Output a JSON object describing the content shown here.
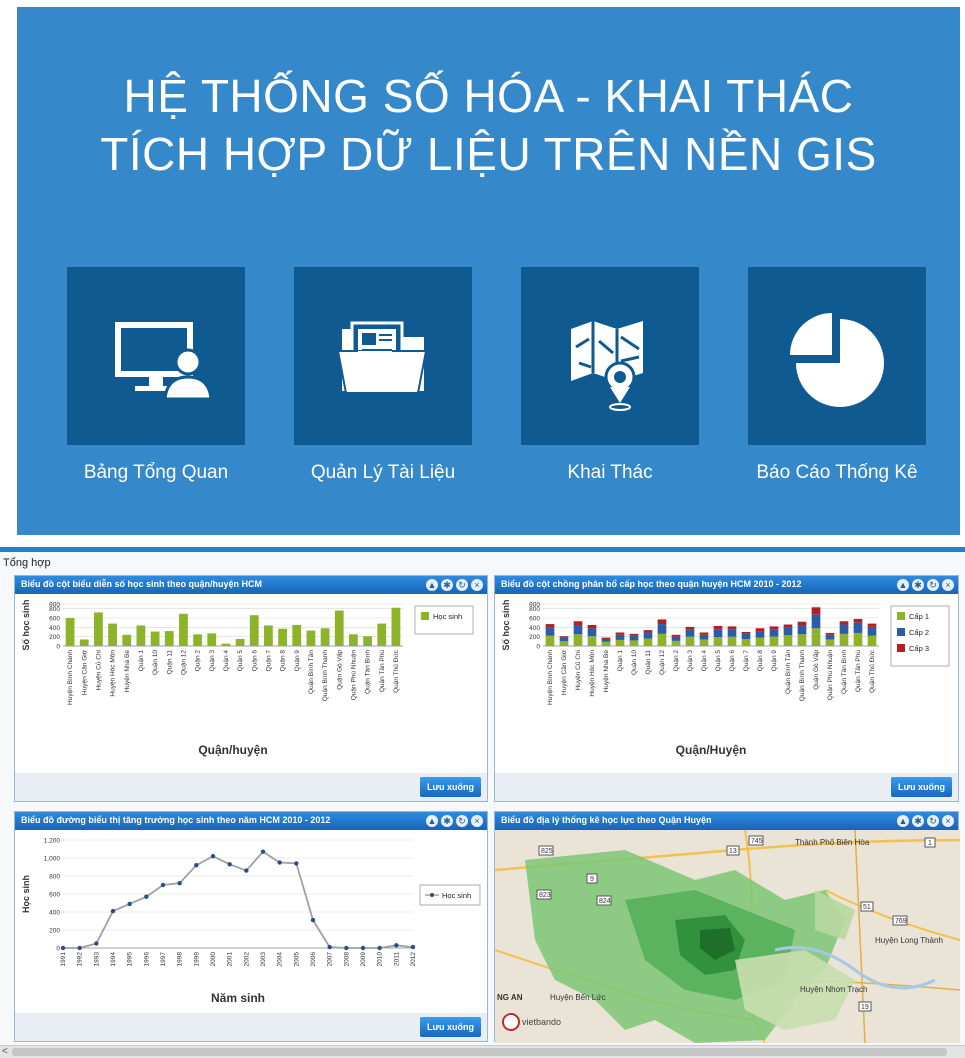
{
  "hero": {
    "title_line1": "HỆ THỐNG SỐ HÓA - KHAI THÁC",
    "title_line2": "TÍCH HỢP DỮ LIỆU TRÊN NỀN GIS",
    "tiles": [
      {
        "label": "Bảng Tổng Quan",
        "icon": "monitor-user-icon"
      },
      {
        "label": "Quản Lý Tài Liệu",
        "icon": "folder-documents-icon"
      },
      {
        "label": "Khai Thác",
        "icon": "map-pin-icon"
      },
      {
        "label": "Báo Cáo Thống Kê",
        "icon": "pie-chart-icon"
      }
    ]
  },
  "dashboard": {
    "title": "Tổng hợp",
    "save_label": "Lưu xuống",
    "panels": [
      {
        "title": "Biểu đồ cột biểu diễn số học sinh theo quận/huyện HCM"
      },
      {
        "title": "Biểu đồ cột chồng phân bổ cấp học theo quận huyện HCM 2010 - 2012"
      },
      {
        "title": "Biểu đồ đường biểu thị tăng trưởng học sinh theo năm HCM 2010 - 2012"
      },
      {
        "title": "Biểu đồ địa lý thống kê học lực theo Quận Huyện"
      }
    ],
    "map_labels": {
      "l1": "Thành Phố Biên Hòa",
      "l2": "Huyện Long Thành",
      "l3": "Huyện Nhơn Trạch",
      "l4": "Huyện Bến Lức",
      "l5": "NG AN",
      "l6": "vietbando",
      "r1": "825",
      "r2": "9",
      "r3": "824",
      "r4": "823",
      "r5": "13",
      "r6": "1",
      "r7": "51",
      "r8": "769",
      "r9": "19",
      "r10": "745"
    }
  },
  "colors": {
    "hero_bg": "#3588c9",
    "tile_bg": "#0f5a91",
    "panel_header": "#1f6fc0",
    "series_green": "#8db32a",
    "series_blue": "#2a5ca8",
    "series_red": "#b22024",
    "line_color": "#a0a0a0"
  },
  "chart_data": [
    {
      "type": "bar",
      "ylabel": "Số học sinh",
      "xlabel": "Quận/huyện",
      "ylim": [
        0,
        900
      ],
      "yticks": [
        "900",
        "800",
        "600",
        "400",
        "200",
        "0"
      ],
      "categories": [
        "Huyện Bình Chánh",
        "Huyện Cần Giờ",
        "Huyện Củ Chi",
        "Huyện Hóc Môn",
        "Huyện Nhà Bè",
        "Quận 1",
        "Quận 10",
        "Quận 11",
        "Quận 12",
        "Quận 2",
        "Quận 3",
        "Quận 4",
        "Quận 5",
        "Quận 6",
        "Quận 7",
        "Quận 8",
        "Quận 9",
        "Quận Bình Tân",
        "Quận Bình Thạnh",
        "Quận Gò Vấp",
        "Quận Phú Nhuận",
        "Quận Tân Bình",
        "Quận Tân Phú",
        "Quận Thủ Đức"
      ],
      "series": [
        {
          "name": "Học sinh",
          "values": [
            600,
            140,
            720,
            480,
            240,
            440,
            310,
            320,
            690,
            250,
            270,
            50,
            150,
            660,
            440,
            370,
            450,
            330,
            380,
            760,
            250,
            210,
            480,
            820
          ]
        }
      ],
      "legend": "right",
      "grid": true
    },
    {
      "type": "bar",
      "stacked": true,
      "ylabel": "Số học sinh",
      "xlabel": "Quận/Huyện",
      "ylim": [
        0,
        900
      ],
      "yticks": [
        "900",
        "800",
        "600",
        "400",
        "200",
        "0"
      ],
      "categories": [
        "Huyện Bình Chánh",
        "Huyện Cần Giờ",
        "Huyện Củ Chi",
        "Huyện Hóc Môn",
        "Huyện Nhà Bè",
        "Quận 1",
        "Quận 10",
        "Quận 11",
        "Quận 12",
        "Quận 2",
        "Quận 3",
        "Quận 4",
        "Quận 5",
        "Quận 6",
        "Quận 7",
        "Quận 8",
        "Quận 9",
        "Quận Bình Tân",
        "Quận Bình Thạnh",
        "Quận Gò Vấp",
        "Quận Phú Nhuận",
        "Quận Tân Bình",
        "Quận Tân Phú",
        "Quận Thủ Đức"
      ],
      "series": [
        {
          "name": "Cấp 1",
          "values": [
            220,
            100,
            250,
            210,
            90,
            130,
            120,
            160,
            260,
            110,
            200,
            140,
            190,
            200,
            150,
            180,
            200,
            230,
            250,
            380,
            140,
            260,
            280,
            220
          ]
        },
        {
          "name": "Cấp 2",
          "values": [
            180,
            80,
            200,
            170,
            60,
            110,
            100,
            130,
            210,
            90,
            150,
            100,
            170,
            160,
            110,
            140,
            160,
            170,
            190,
            300,
            100,
            200,
            220,
            190
          ]
        },
        {
          "name": "Cấp 3",
          "values": [
            70,
            30,
            80,
            70,
            30,
            50,
            40,
            50,
            100,
            40,
            60,
            50,
            70,
            60,
            40,
            60,
            60,
            60,
            80,
            150,
            40,
            70,
            80,
            70
          ]
        }
      ],
      "legend": "right",
      "grid": true
    },
    {
      "type": "line",
      "ylabel": "Học sinh",
      "xlabel": "Năm sinh",
      "ylim": [
        0,
        1200
      ],
      "yticks": [
        "1.200",
        "1.000",
        "800",
        "600",
        "400",
        "200",
        "0"
      ],
      "x": [
        "1991",
        "1992",
        "1993",
        "1994",
        "1995",
        "1996",
        "1997",
        "1998",
        "1999",
        "2000",
        "2001",
        "2002",
        "2003",
        "2004",
        "2005",
        "2006",
        "2007",
        "2008",
        "2009",
        "2010",
        "2011",
        "2012"
      ],
      "series": [
        {
          "name": "Học sinh",
          "values": [
            0,
            0,
            50,
            410,
            490,
            570,
            700,
            720,
            920,
            1020,
            930,
            860,
            1070,
            950,
            940,
            310,
            10,
            0,
            0,
            0,
            30,
            10
          ]
        }
      ],
      "legend": "right",
      "grid": true
    }
  ]
}
